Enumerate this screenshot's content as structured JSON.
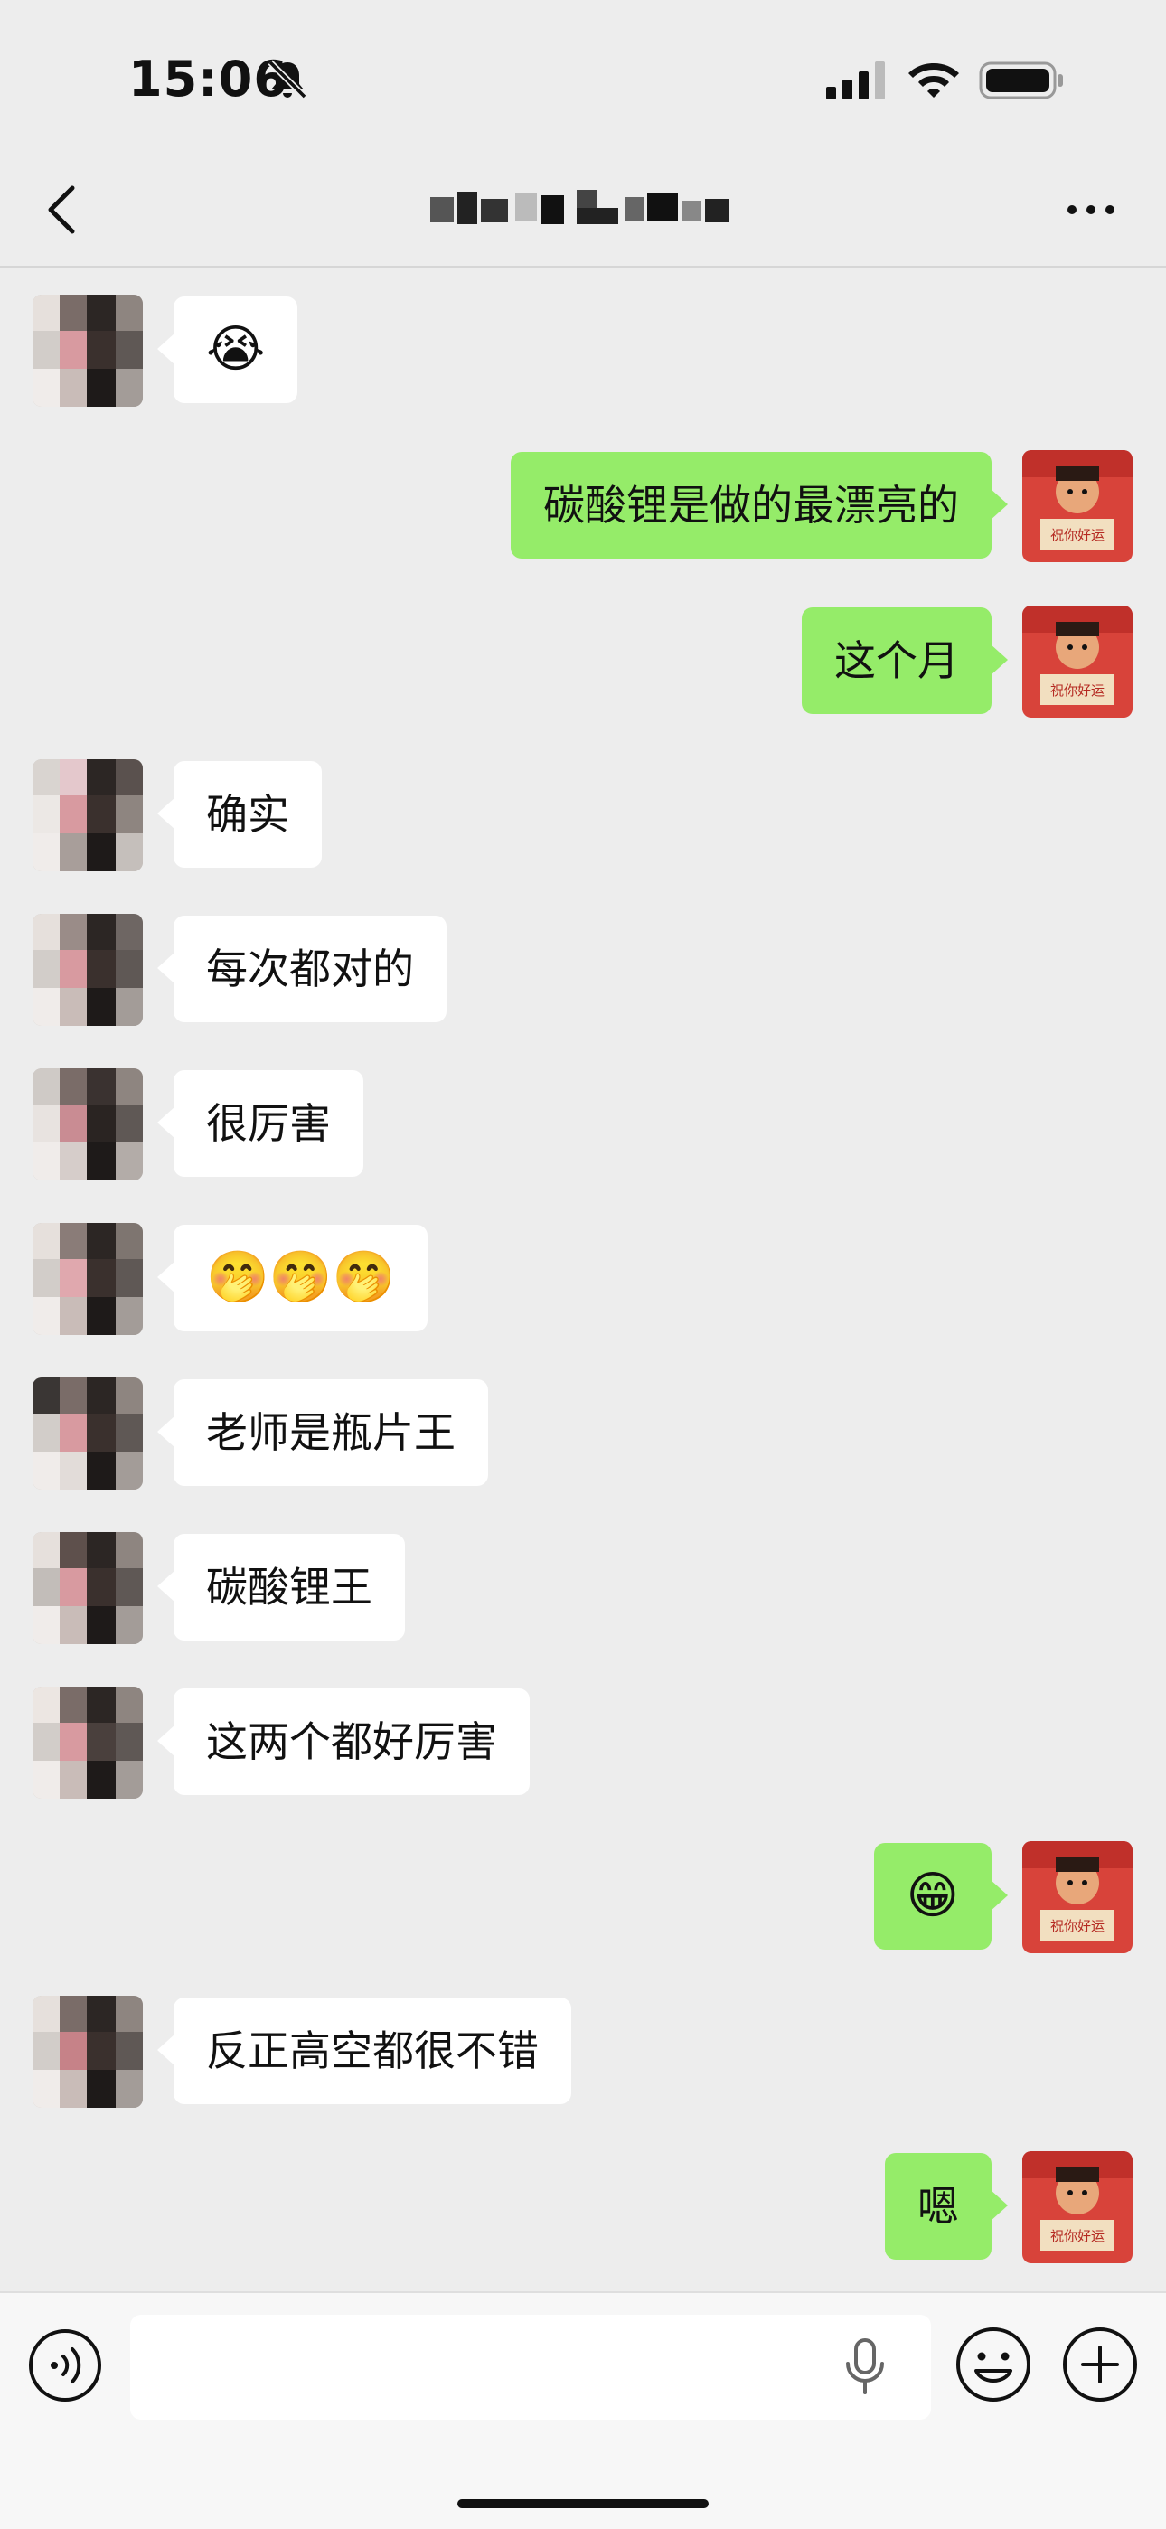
{
  "status_bar": {
    "time": "15:06"
  },
  "chat": {
    "title": ""
  },
  "messages": [
    {
      "side": "left",
      "text": "😭"
    },
    {
      "side": "right",
      "text": "碳酸锂是做的最漂亮的"
    },
    {
      "side": "right",
      "text": "这个月"
    },
    {
      "side": "left",
      "text": "确实"
    },
    {
      "side": "left",
      "text": "每次都对的"
    },
    {
      "side": "left",
      "text": "很厉害"
    },
    {
      "side": "left",
      "text": "🤭🤭🤭"
    },
    {
      "side": "left",
      "text": "老师是瓶片王"
    },
    {
      "side": "left",
      "text": "碳酸锂王"
    },
    {
      "side": "left",
      "text": "这两个都好厉害"
    },
    {
      "side": "right",
      "text": "😁"
    },
    {
      "side": "left",
      "text": "反正高空都很不错"
    },
    {
      "side": "right",
      "text": "嗯"
    }
  ],
  "my_avatar": {
    "caption": "祝你好运"
  },
  "input_bar": {
    "value": "",
    "placeholder": ""
  },
  "colors": {
    "background": "#ededed",
    "my_bubble": "#95ec69",
    "their_bubble": "#ffffff",
    "input_bar": "#f7f7f7"
  },
  "icons": [
    "back-icon",
    "more-icon",
    "mute-icon",
    "signal-icon",
    "wifi-icon",
    "battery-icon",
    "voice-icon",
    "mic-icon",
    "emoji-icon",
    "add-icon"
  ]
}
